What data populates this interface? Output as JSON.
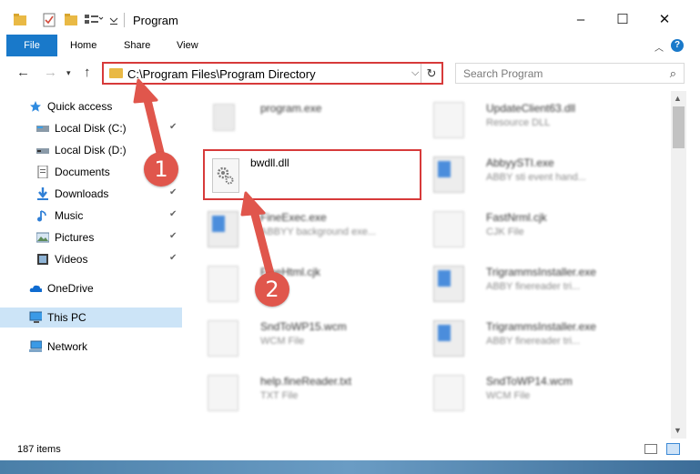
{
  "window": {
    "title": "Program",
    "minimize_glyph": "–",
    "maximize_glyph": "☐",
    "close_glyph": "✕"
  },
  "ribbon": {
    "tabs": [
      "File",
      "Home",
      "Share",
      "View"
    ],
    "help_glyph": "?"
  },
  "nav": {
    "address_path": "C:\\Program Files\\Program Directory",
    "search_placeholder": "Search Program"
  },
  "sidebar": {
    "items": [
      {
        "label": "Quick access",
        "icon": "star-icon"
      },
      {
        "label": "Local Disk (C:)",
        "icon": "drive-icon"
      },
      {
        "label": "Local Disk (D:)",
        "icon": "drive-icon"
      },
      {
        "label": "Documents",
        "icon": "documents-icon"
      },
      {
        "label": "Downloads",
        "icon": "download-icon"
      },
      {
        "label": "Music",
        "icon": "music-icon"
      },
      {
        "label": "Pictures",
        "icon": "pictures-icon"
      },
      {
        "label": "Videos",
        "icon": "videos-icon"
      },
      {
        "label": "OneDrive",
        "icon": "cloud-icon"
      },
      {
        "label": "This PC",
        "icon": "computer-icon"
      },
      {
        "label": "Network",
        "icon": "network-icon"
      }
    ]
  },
  "files": {
    "focused": {
      "name": "bwdll.dll"
    },
    "left": [
      {
        "name": "program.exe",
        "desc": ""
      },
      {
        "name": "FineExec.exe",
        "desc": "ABBYY background exe..."
      },
      {
        "name": "FineHtml.cjk",
        "desc": ""
      },
      {
        "name": "SndToWP15.wcm",
        "desc": "WCM File"
      },
      {
        "name": "help.fineReader.txt",
        "desc": "TXT File"
      }
    ],
    "right": [
      {
        "name": "UpdateClient63.dll",
        "desc": "Resource DLL"
      },
      {
        "name": "AbbyySTI.exe",
        "desc": "ABBY sti event hand..."
      },
      {
        "name": "FastNrml.cjk",
        "desc": "CJK File"
      },
      {
        "name": "TrigrammsInstaller.exe",
        "desc": "ABBY finereader tri..."
      },
      {
        "name": "TrigrammsInstaller.exe",
        "desc": "ABBY finereader tri..."
      },
      {
        "name": "SndToWP14.wcm",
        "desc": "WCM File"
      }
    ]
  },
  "status": {
    "item_count": "187 items"
  },
  "annotations": {
    "step1": "1",
    "step2": "2"
  },
  "colors": {
    "accent": "#1979ca",
    "highlight": "#d73a3a",
    "arrow": "#e0564c"
  }
}
